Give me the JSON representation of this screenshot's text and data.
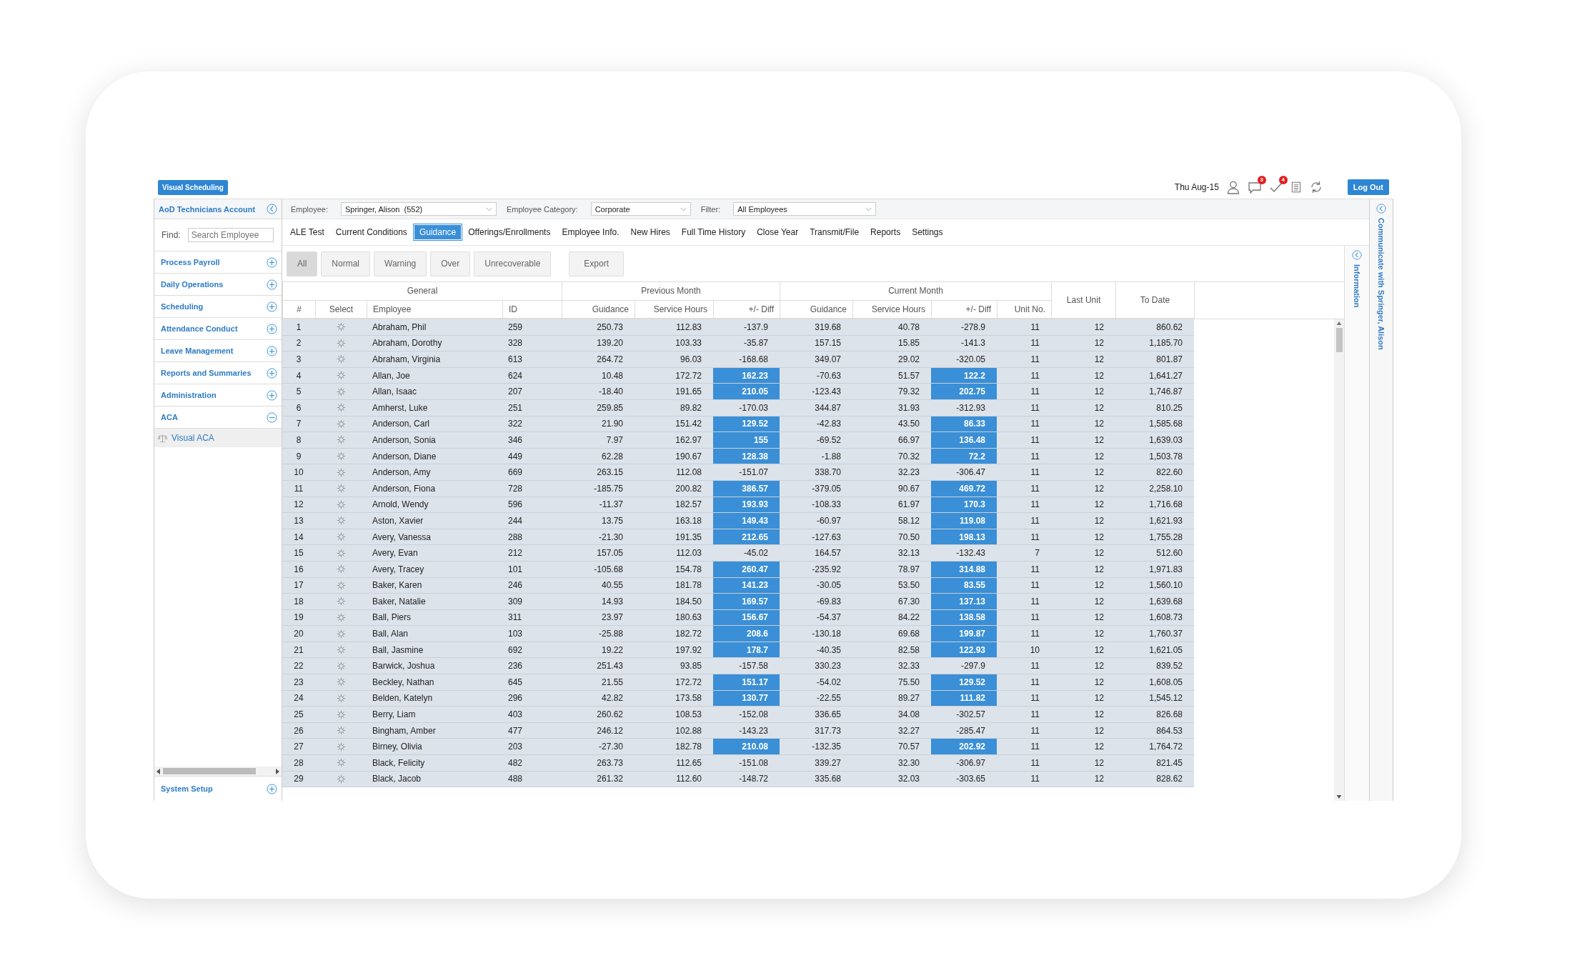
{
  "app_button": "Visual Scheduling",
  "date": "Thu Aug-15",
  "alerts": [
    {
      "kind": "chat",
      "badge": "3"
    },
    {
      "kind": "check",
      "badge": "4"
    }
  ],
  "logout": "Log Out",
  "sidebar": {
    "title": "AoD Technicians Account",
    "find_label": "Find:",
    "search_placeholder": "Search Employee",
    "items": [
      {
        "label": "Process Payroll",
        "expanded": false
      },
      {
        "label": "Daily Operations",
        "expanded": false
      },
      {
        "label": "Scheduling",
        "expanded": false
      },
      {
        "label": "Attendance Conduct",
        "expanded": false
      },
      {
        "label": "Leave Management",
        "expanded": false
      },
      {
        "label": "Reports and Summaries",
        "expanded": false
      },
      {
        "label": "Administration",
        "expanded": false
      },
      {
        "label": "ACA",
        "expanded": true,
        "children": [
          {
            "label": "Visual ACA"
          }
        ]
      }
    ],
    "footer_item": {
      "label": "System Setup",
      "expanded": false
    }
  },
  "selectors": [
    {
      "label": "Employee:",
      "value": "Springer, Alison  (552)"
    },
    {
      "label": "Employee Category:",
      "value": "Corporate"
    },
    {
      "label": "Filter:",
      "value": "All Employees"
    }
  ],
  "tabs": [
    {
      "label": "ALE Test",
      "selected": false
    },
    {
      "label": "Current Conditions",
      "selected": false
    },
    {
      "label": "Guidance",
      "selected": true
    },
    {
      "label": "Offerings/Enrollments",
      "selected": false
    },
    {
      "label": "Employee Info.",
      "selected": false
    },
    {
      "label": "New Hires",
      "selected": false
    },
    {
      "label": "Full Time History",
      "selected": false
    },
    {
      "label": "Close Year",
      "selected": false
    },
    {
      "label": "Transmit/File",
      "selected": false
    },
    {
      "label": "Reports",
      "selected": false
    },
    {
      "label": "Settings",
      "selected": false
    }
  ],
  "status_buttons": [
    {
      "label": "All",
      "selected": true
    },
    {
      "label": "Normal",
      "selected": false
    },
    {
      "label": "Warning",
      "selected": false
    },
    {
      "label": "Over",
      "selected": false
    },
    {
      "label": "Unrecoverable",
      "selected": false
    }
  ],
  "export_button": "Export",
  "side_panels": [
    "Information",
    "Communicate with Springer, Alison"
  ],
  "table": {
    "groups": [
      {
        "label": "General",
        "columns": [
          "#",
          "Select",
          "Employee",
          "ID"
        ]
      },
      {
        "label": "Previous Month",
        "columns": [
          "Guidance",
          "Service Hours",
          "+/- Diff"
        ]
      },
      {
        "label": "Current Month",
        "columns": [
          "Guidance",
          "Service Hours",
          "+/- Diff",
          "Unit No."
        ]
      },
      {
        "label": "Last Unit"
      },
      {
        "label": "To Date"
      }
    ],
    "rows": [
      {
        "n": "1",
        "name": "Abraham, Phil",
        "id": "259",
        "pg": "250.73",
        "ph": "112.83",
        "pd": "-137.9",
        "po": false,
        "cg": "319.68",
        "ch": "40.78",
        "cd": "-278.9",
        "co": false,
        "unit": "11",
        "last": "12",
        "total": "860.62"
      },
      {
        "n": "2",
        "name": "Abraham, Dorothy",
        "id": "328",
        "pg": "139.20",
        "ph": "103.33",
        "pd": "-35.87",
        "po": false,
        "cg": "157.15",
        "ch": "15.85",
        "cd": "-141.3",
        "co": false,
        "unit": "11",
        "last": "12",
        "total": "1,185.70"
      },
      {
        "n": "3",
        "name": "Abraham, Virginia",
        "id": "613",
        "pg": "264.72",
        "ph": "96.03",
        "pd": "-168.68",
        "po": false,
        "cg": "349.07",
        "ch": "29.02",
        "cd": "-320.05",
        "co": false,
        "unit": "11",
        "last": "12",
        "total": "801.87"
      },
      {
        "n": "4",
        "name": "Allan, Joe",
        "id": "624",
        "pg": "10.48",
        "ph": "172.72",
        "pd": "162.23",
        "po": true,
        "cg": "-70.63",
        "ch": "51.57",
        "cd": "122.2",
        "co": true,
        "unit": "11",
        "last": "12",
        "total": "1,641.27"
      },
      {
        "n": "5",
        "name": "Allan, Isaac",
        "id": "207",
        "pg": "-18.40",
        "ph": "191.65",
        "pd": "210.05",
        "po": true,
        "cg": "-123.43",
        "ch": "79.32",
        "cd": "202.75",
        "co": true,
        "unit": "11",
        "last": "12",
        "total": "1,746.87"
      },
      {
        "n": "6",
        "name": "Amherst, Luke",
        "id": "251",
        "pg": "259.85",
        "ph": "89.82",
        "pd": "-170.03",
        "po": false,
        "cg": "344.87",
        "ch": "31.93",
        "cd": "-312.93",
        "co": false,
        "unit": "11",
        "last": "12",
        "total": "810.25"
      },
      {
        "n": "7",
        "name": "Anderson, Carl",
        "id": "322",
        "pg": "21.90",
        "ph": "151.42",
        "pd": "129.52",
        "po": true,
        "cg": "-42.83",
        "ch": "43.50",
        "cd": "86.33",
        "co": true,
        "unit": "11",
        "last": "12",
        "total": "1,585.68"
      },
      {
        "n": "8",
        "name": "Anderson, Sonia",
        "id": "346",
        "pg": "7.97",
        "ph": "162.97",
        "pd": "155",
        "po": true,
        "cg": "-69.52",
        "ch": "66.97",
        "cd": "136.48",
        "co": true,
        "unit": "11",
        "last": "12",
        "total": "1,639.03"
      },
      {
        "n": "9",
        "name": "Anderson, Diane",
        "id": "449",
        "pg": "62.28",
        "ph": "190.67",
        "pd": "128.38",
        "po": true,
        "cg": "-1.88",
        "ch": "70.32",
        "cd": "72.2",
        "co": true,
        "unit": "11",
        "last": "12",
        "total": "1,503.78"
      },
      {
        "n": "10",
        "name": "Anderson, Amy",
        "id": "669",
        "pg": "263.15",
        "ph": "112.08",
        "pd": "-151.07",
        "po": false,
        "cg": "338.70",
        "ch": "32.23",
        "cd": "-306.47",
        "co": false,
        "unit": "11",
        "last": "12",
        "total": "822.60"
      },
      {
        "n": "11",
        "name": "Anderson, Fiona",
        "id": "728",
        "pg": "-185.75",
        "ph": "200.82",
        "pd": "386.57",
        "po": true,
        "cg": "-379.05",
        "ch": "90.67",
        "cd": "469.72",
        "co": true,
        "unit": "11",
        "last": "12",
        "total": "2,258.10"
      },
      {
        "n": "12",
        "name": "Arnold, Wendy",
        "id": "596",
        "pg": "-11.37",
        "ph": "182.57",
        "pd": "193.93",
        "po": true,
        "cg": "-108.33",
        "ch": "61.97",
        "cd": "170.3",
        "co": true,
        "unit": "11",
        "last": "12",
        "total": "1,716.68"
      },
      {
        "n": "13",
        "name": "Aston, Xavier",
        "id": "244",
        "pg": "13.75",
        "ph": "163.18",
        "pd": "149.43",
        "po": true,
        "cg": "-60.97",
        "ch": "58.12",
        "cd": "119.08",
        "co": true,
        "unit": "11",
        "last": "12",
        "total": "1,621.93"
      },
      {
        "n": "14",
        "name": "Avery, Vanessa",
        "id": "288",
        "pg": "-21.30",
        "ph": "191.35",
        "pd": "212.65",
        "po": true,
        "cg": "-127.63",
        "ch": "70.50",
        "cd": "198.13",
        "co": true,
        "unit": "11",
        "last": "12",
        "total": "1,755.28"
      },
      {
        "n": "15",
        "name": "Avery, Evan",
        "id": "212",
        "pg": "157.05",
        "ph": "112.03",
        "pd": "-45.02",
        "po": false,
        "cg": "164.57",
        "ch": "32.13",
        "cd": "-132.43",
        "co": false,
        "unit": "7",
        "last": "12",
        "total": "512.60"
      },
      {
        "n": "16",
        "name": "Avery, Tracey",
        "id": "101",
        "pg": "-105.68",
        "ph": "154.78",
        "pd": "260.47",
        "po": true,
        "cg": "-235.92",
        "ch": "78.97",
        "cd": "314.88",
        "co": true,
        "unit": "11",
        "last": "12",
        "total": "1,971.83"
      },
      {
        "n": "17",
        "name": "Baker, Karen",
        "id": "246",
        "pg": "40.55",
        "ph": "181.78",
        "pd": "141.23",
        "po": true,
        "cg": "-30.05",
        "ch": "53.50",
        "cd": "83.55",
        "co": true,
        "unit": "11",
        "last": "12",
        "total": "1,560.10"
      },
      {
        "n": "18",
        "name": "Baker, Natalie",
        "id": "309",
        "pg": "14.93",
        "ph": "184.50",
        "pd": "169.57",
        "po": true,
        "cg": "-69.83",
        "ch": "67.30",
        "cd": "137.13",
        "co": true,
        "unit": "11",
        "last": "12",
        "total": "1,639.68"
      },
      {
        "n": "19",
        "name": "Ball, Piers",
        "id": "311",
        "pg": "23.97",
        "ph": "180.63",
        "pd": "156.67",
        "po": true,
        "cg": "-54.37",
        "ch": "84.22",
        "cd": "138.58",
        "co": true,
        "unit": "11",
        "last": "12",
        "total": "1,608.73"
      },
      {
        "n": "20",
        "name": "Ball, Alan",
        "id": "103",
        "pg": "-25.88",
        "ph": "182.72",
        "pd": "208.6",
        "po": true,
        "cg": "-130.18",
        "ch": "69.68",
        "cd": "199.87",
        "co": true,
        "unit": "11",
        "last": "12",
        "total": "1,760.37"
      },
      {
        "n": "21",
        "name": "Ball, Jasmine",
        "id": "692",
        "pg": "19.22",
        "ph": "197.92",
        "pd": "178.7",
        "po": true,
        "cg": "-40.35",
        "ch": "82.58",
        "cd": "122.93",
        "co": true,
        "unit": "10",
        "last": "12",
        "total": "1,621.05"
      },
      {
        "n": "22",
        "name": "Barwick, Joshua",
        "id": "236",
        "pg": "251.43",
        "ph": "93.85",
        "pd": "-157.58",
        "po": false,
        "cg": "330.23",
        "ch": "32.33",
        "cd": "-297.9",
        "co": false,
        "unit": "11",
        "last": "12",
        "total": "839.52"
      },
      {
        "n": "23",
        "name": "Beckley, Nathan",
        "id": "645",
        "pg": "21.55",
        "ph": "172.72",
        "pd": "151.17",
        "po": true,
        "cg": "-54.02",
        "ch": "75.50",
        "cd": "129.52",
        "co": true,
        "unit": "11",
        "last": "12",
        "total": "1,608.05"
      },
      {
        "n": "24",
        "name": "Belden, Katelyn",
        "id": "296",
        "pg": "42.82",
        "ph": "173.58",
        "pd": "130.77",
        "po": true,
        "cg": "-22.55",
        "ch": "89.27",
        "cd": "111.82",
        "co": true,
        "unit": "11",
        "last": "12",
        "total": "1,545.12"
      },
      {
        "n": "25",
        "name": "Berry, Liam",
        "id": "403",
        "pg": "260.62",
        "ph": "108.53",
        "pd": "-152.08",
        "po": false,
        "cg": "336.65",
        "ch": "34.08",
        "cd": "-302.57",
        "co": false,
        "unit": "11",
        "last": "12",
        "total": "826.68"
      },
      {
        "n": "26",
        "name": "Bingham, Amber",
        "id": "477",
        "pg": "246.12",
        "ph": "102.88",
        "pd": "-143.23",
        "po": false,
        "cg": "317.73",
        "ch": "32.27",
        "cd": "-285.47",
        "co": false,
        "unit": "11",
        "last": "12",
        "total": "864.53"
      },
      {
        "n": "27",
        "name": "Birney, Olivia",
        "id": "203",
        "pg": "-27.30",
        "ph": "182.78",
        "pd": "210.08",
        "po": true,
        "cg": "-132.35",
        "ch": "70.57",
        "cd": "202.92",
        "co": true,
        "unit": "11",
        "last": "12",
        "total": "1,764.72"
      },
      {
        "n": "28",
        "name": "Black, Felicity",
        "id": "482",
        "pg": "263.73",
        "ph": "112.65",
        "pd": "-151.08",
        "po": false,
        "cg": "339.27",
        "ch": "32.30",
        "cd": "-306.97",
        "co": false,
        "unit": "11",
        "last": "12",
        "total": "821.45"
      },
      {
        "n": "29",
        "name": "Black, Jacob",
        "id": "488",
        "pg": "261.32",
        "ph": "112.60",
        "pd": "-148.72",
        "po": false,
        "cg": "335.68",
        "ch": "32.03",
        "cd": "-303.65",
        "co": false,
        "unit": "11",
        "last": "12",
        "total": "828.62"
      }
    ]
  }
}
